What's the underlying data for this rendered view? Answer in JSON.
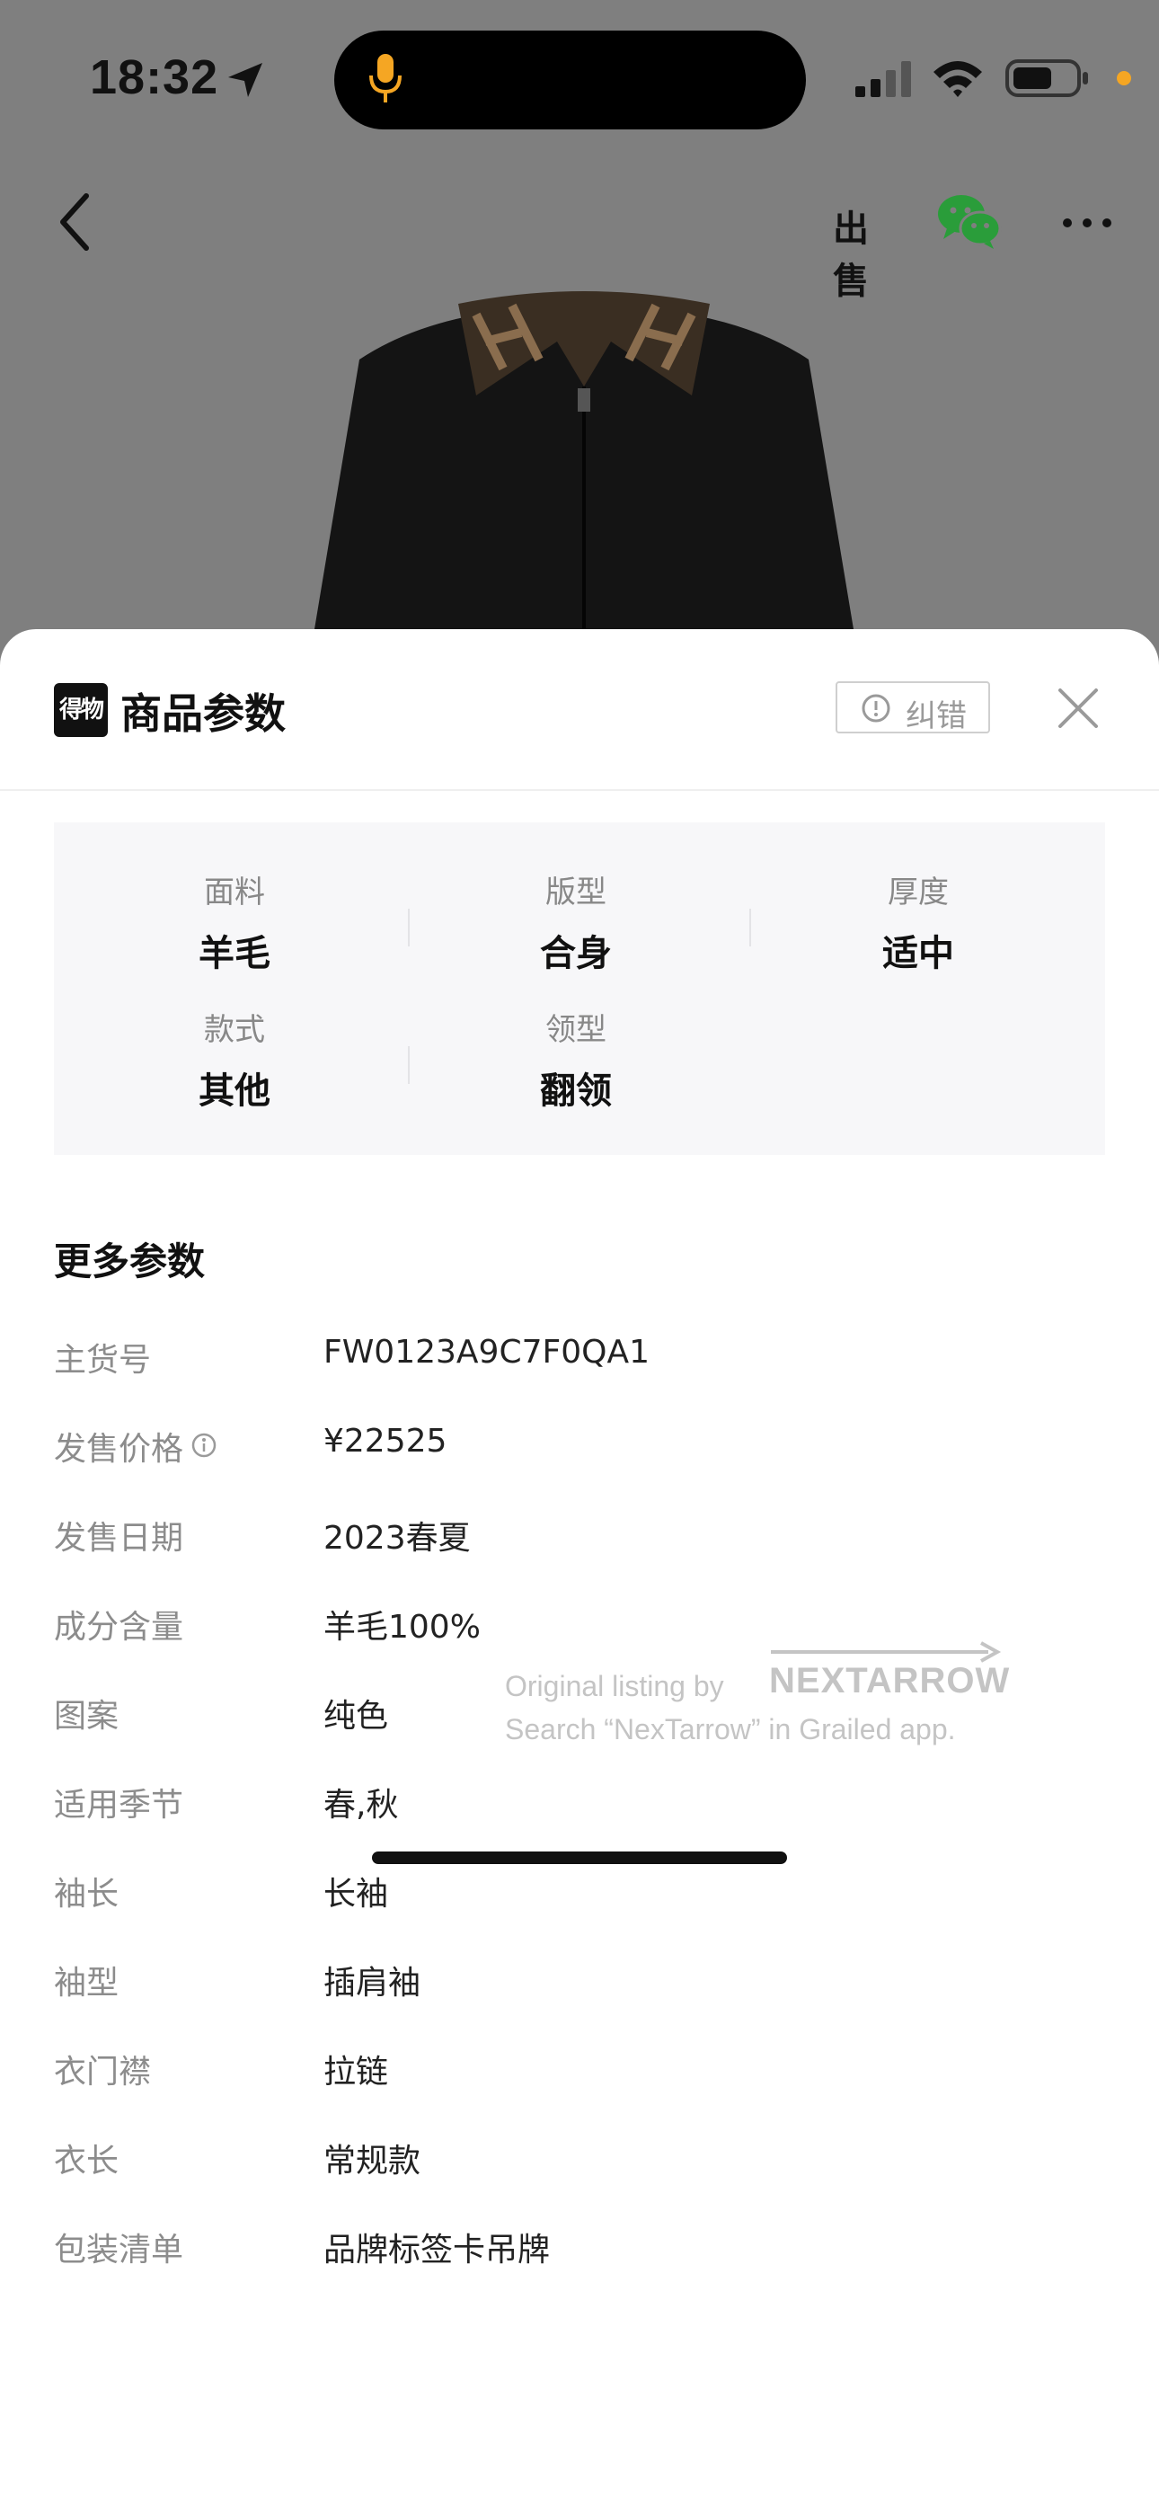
{
  "status_bar": {
    "time": "18:32"
  },
  "nav": {
    "sell_label": "出售"
  },
  "sheet": {
    "logo_text": "得物",
    "title": "商品参数",
    "correction_label": "纠错"
  },
  "attributes": [
    {
      "label": "面料",
      "value": "羊毛"
    },
    {
      "label": "版型",
      "value": "合身"
    },
    {
      "label": "厚度",
      "value": "适中"
    },
    {
      "label": "款式",
      "value": "其他"
    },
    {
      "label": "领型",
      "value": "翻领"
    }
  ],
  "more_params": {
    "title": "更多参数",
    "rows": [
      {
        "label": "主货号",
        "value": "FW0123A9C7F0QA1"
      },
      {
        "label": "发售价格",
        "value": "¥22525"
      },
      {
        "label": "发售日期",
        "value": "2023春夏"
      },
      {
        "label": "成分含量",
        "value": "羊毛100%"
      },
      {
        "label": "图案",
        "value": "纯色"
      },
      {
        "label": "适用季节",
        "value": "春,秋"
      },
      {
        "label": "袖长",
        "value": "长袖"
      },
      {
        "label": "袖型",
        "value": "插肩袖"
      },
      {
        "label": "衣门襟",
        "value": "拉链"
      },
      {
        "label": "衣长",
        "value": "常规款"
      },
      {
        "label": "包装清单",
        "value": "品牌标签卡吊牌"
      }
    ]
  },
  "watermark": {
    "line1": "Original listing by",
    "brand": "NEXTARROW",
    "line2": "Search “NexTarrow” in Grailed app."
  },
  "colors": {
    "dim_overlay": "#7f7f7f",
    "wechat_green": "#2a9d3a",
    "mic_orange": "#f5a623"
  }
}
